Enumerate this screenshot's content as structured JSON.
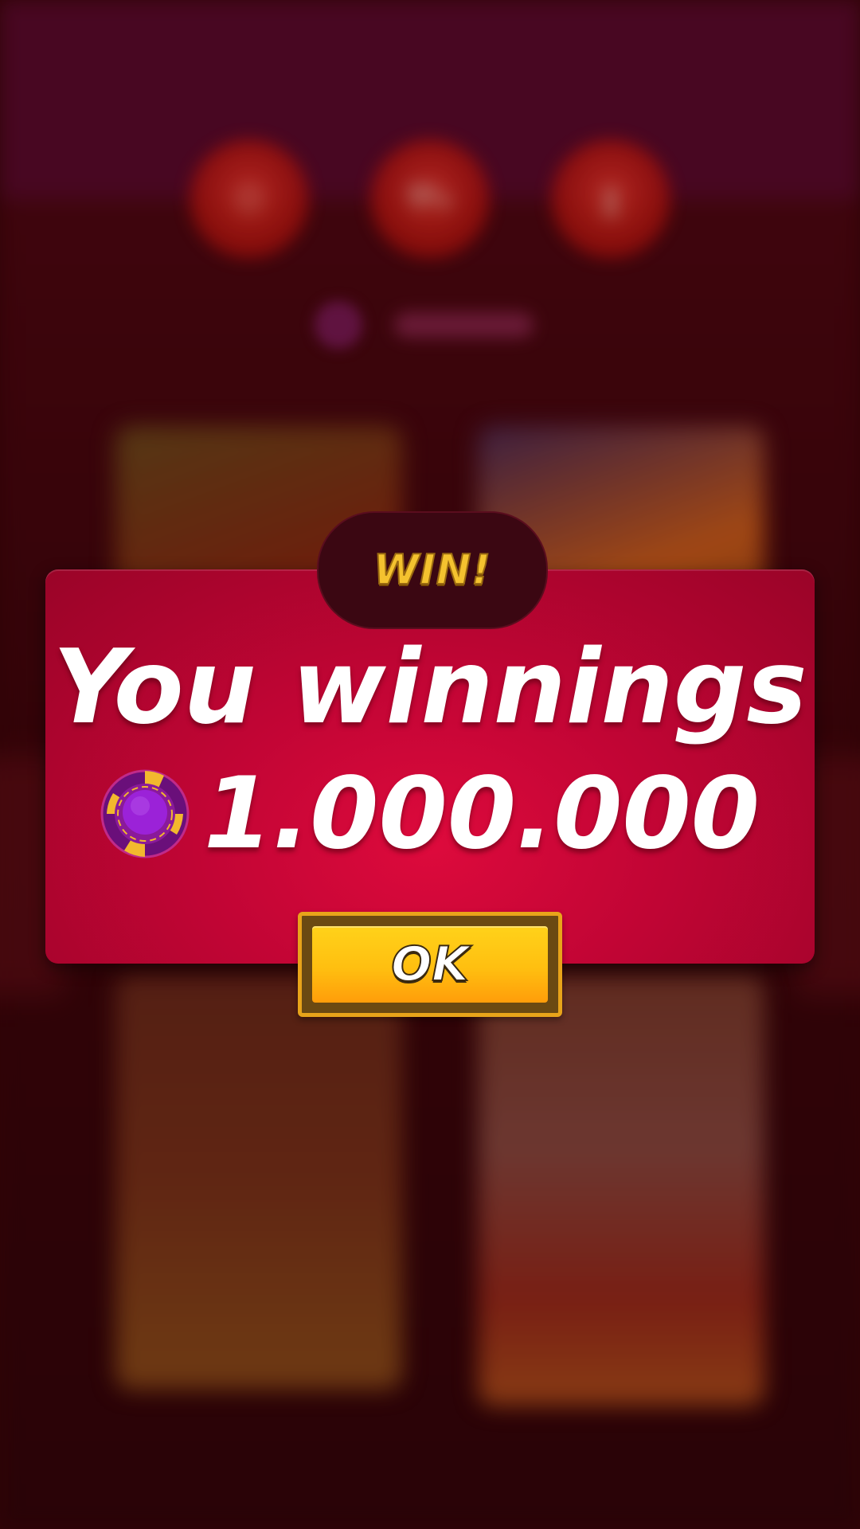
{
  "background": {
    "top_icons": [
      "settings-icon",
      "shop-icon",
      "leaderboard-icon"
    ],
    "cards": [
      "game-card-1",
      "game-card-2",
      "game-card-3",
      "game-card-4"
    ]
  },
  "popup": {
    "badge_label": "WIN!",
    "title": "You winnings",
    "amount": "1.000.000",
    "currency_icon": "poker-chip-icon",
    "ok_label": "OK"
  },
  "colors": {
    "panel": "#c30535",
    "badge": "#3b0712",
    "gold": "#f4c22f",
    "button": "#ffbf10",
    "chip": "#8a1ac0"
  }
}
